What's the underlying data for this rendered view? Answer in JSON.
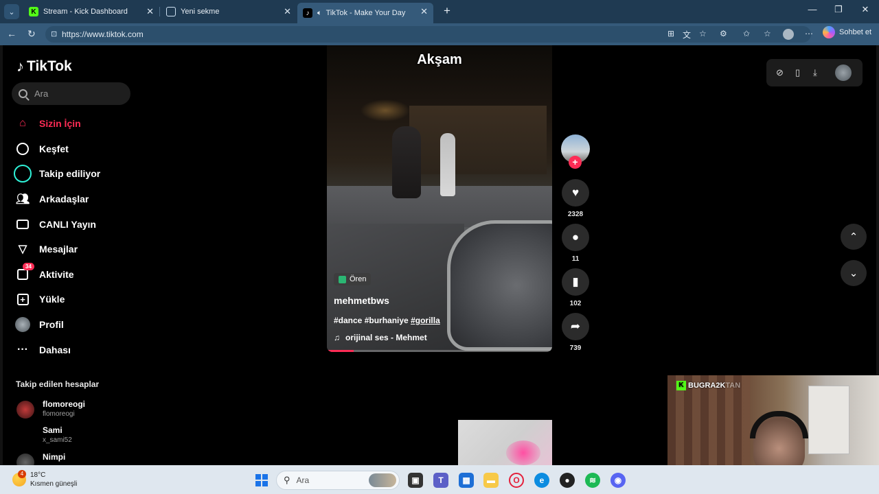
{
  "browser": {
    "tabs": [
      {
        "title": "Stream - Kick Dashboard",
        "favicon": "K"
      },
      {
        "title": "Yeni sekme",
        "favicon": "tab-icon"
      },
      {
        "title": "TikTok - Make Your Day",
        "favicon": "tiktok-icon"
      }
    ],
    "url": "https://www.tiktok.com",
    "copilot_label": "Sohbet et"
  },
  "sidebar": {
    "logo": "TikTok",
    "search_placeholder": "Ara",
    "nav": [
      {
        "label": "Sizin İçin",
        "icon": "home-icon",
        "active": true
      },
      {
        "label": "Keşfet",
        "icon": "compass-icon"
      },
      {
        "label": "Takip ediliyor",
        "icon": "following-icon"
      },
      {
        "label": "Arkadaşlar",
        "icon": "friends-icon"
      },
      {
        "label": "CANLI Yayın",
        "icon": "live-icon"
      },
      {
        "label": "Mesajlar",
        "icon": "messages-icon"
      },
      {
        "label": "Aktivite",
        "icon": "activity-icon",
        "badge": "34"
      },
      {
        "label": "Yükle",
        "icon": "upload-icon"
      },
      {
        "label": "Profil",
        "icon": "profile-icon"
      },
      {
        "label": "Dahası",
        "icon": "more-icon"
      }
    ],
    "following_title": "Takip edilen hesaplar",
    "following": [
      {
        "name": "flomoreogi",
        "handle": "flomoreogi"
      },
      {
        "name": "Sami",
        "handle": "x_sami52"
      },
      {
        "name": "Nimpi",
        "handle": ""
      }
    ]
  },
  "video": {
    "caption_top": "Akşam",
    "suggestion": "Ören",
    "author": "mehmetbws",
    "tags": "#dance #burhaniye",
    "tag_link": "#gorilla",
    "sound": "orijinal ses - Mehmet",
    "progress": 0.12
  },
  "actions": {
    "likes": "2328",
    "comments": "11",
    "saves": "102",
    "shares": "739"
  },
  "overlay": {
    "stream_tag": "BUGRA2K",
    "stream_tag_suffix": "TAN"
  },
  "taskbar": {
    "temp": "18°C",
    "weather": "Kısmen güneşli",
    "weather_badge": "4",
    "search_placeholder": "Ara"
  },
  "colors": {
    "accent": "#fe2c55",
    "kick": "#53fc18"
  }
}
